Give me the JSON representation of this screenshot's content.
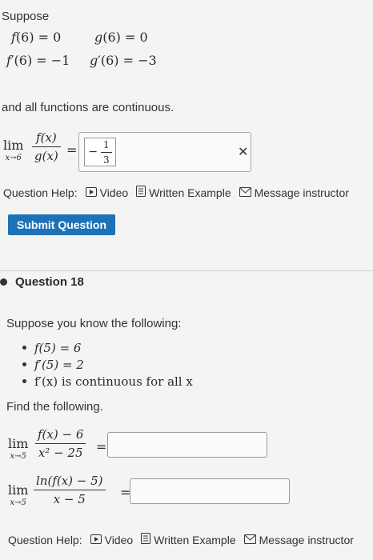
{
  "top": {
    "suppose_label": "Suppose",
    "given": {
      "row1_left": "(6) = 0",
      "row1_right": "(6) = 0",
      "row2_left": "′(6) = −1",
      "row2_right": "′(6) = −3",
      "fname": "f",
      "gname": "g"
    },
    "continuous_text": "and all functions are continuous.",
    "limit": {
      "word": "lim",
      "sub": "x→6",
      "numerator": "f(x)",
      "denominator": "g(x)",
      "equals": "=",
      "answer_sign": "−",
      "answer_num": "1",
      "answer_den": "3",
      "clear_symbol": "✕"
    },
    "help": {
      "label": "Question Help:",
      "video": "Video",
      "written": "Written Example",
      "message": "Message instructor"
    },
    "submit_label": "Submit Question"
  },
  "q18": {
    "title": "Question 18",
    "intro": "Suppose you know the following:",
    "facts": [
      "f(5) = 6",
      "f′(5) = 2",
      "f′(x) is continuous for all x"
    ],
    "find_text": "Find the following.",
    "lim1": {
      "word": "lim",
      "sub": "x→5",
      "numerator": "f(x) − 6",
      "denominator": "x² − 25",
      "equals": "="
    },
    "lim2": {
      "word": "lim",
      "sub": "x→5",
      "numerator": "ln(f(x) − 5)",
      "denominator": "x − 5",
      "equals": "="
    },
    "help": {
      "label": "Question Help:",
      "video": "Video",
      "written": "Written Example",
      "message": "Message instructor"
    }
  },
  "colors": {
    "accent": "#1d72b8",
    "background": "#f4f4f2",
    "text": "#2a2a2a"
  }
}
